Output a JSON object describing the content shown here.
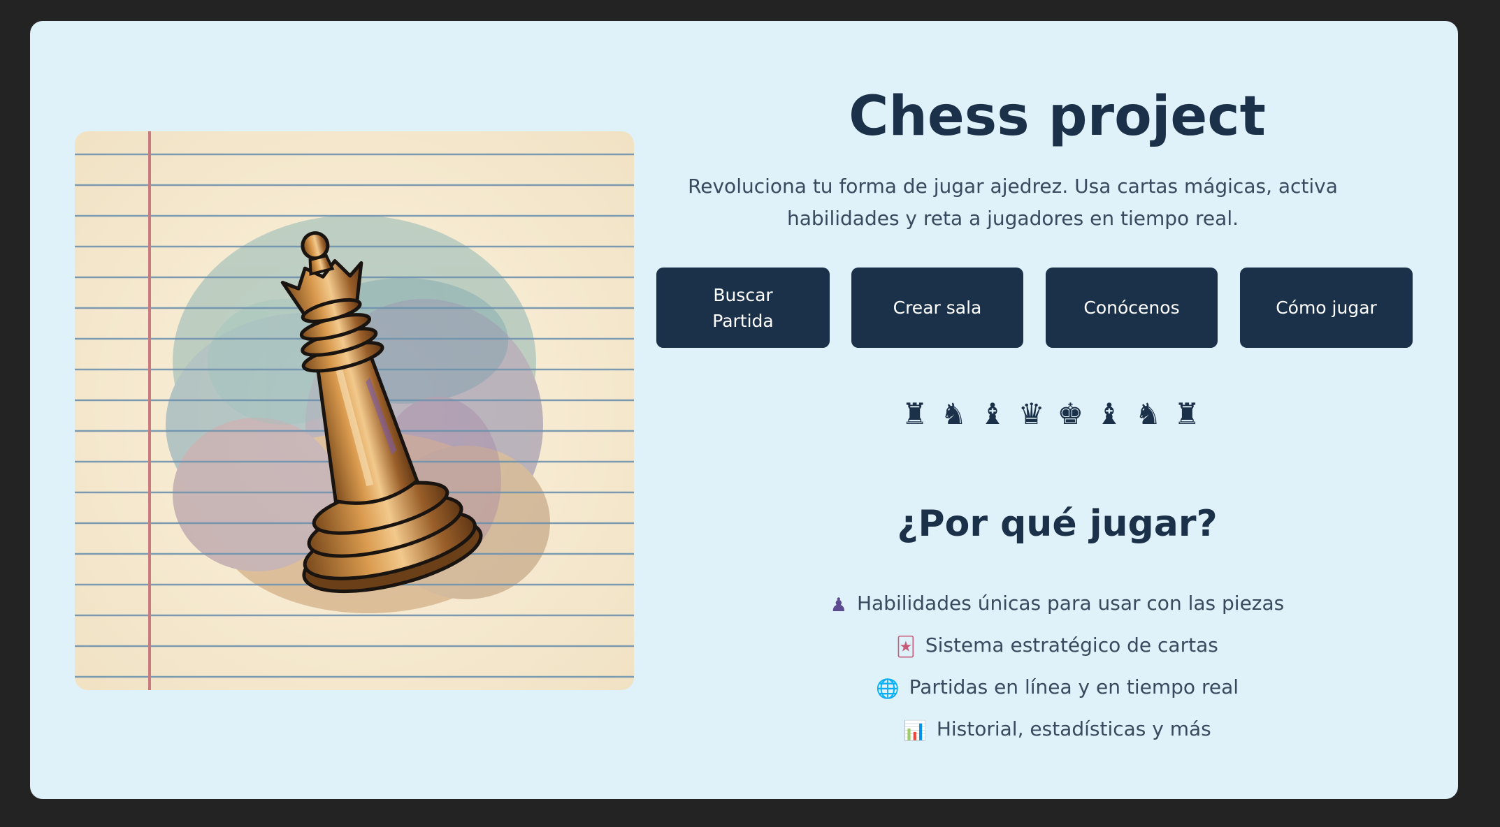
{
  "hero": {
    "title": "Chess project",
    "subtitle": "Revoluciona tu forma de jugar ajedrez. Usa cartas mágicas, activa habilidades y reta a jugadores en tiempo real."
  },
  "actions": [
    {
      "label": "Buscar Partida"
    },
    {
      "label": "Crear sala"
    },
    {
      "label": "Conócenos"
    },
    {
      "label": "Cómo jugar"
    }
  ],
  "pieces_row": "♜♞♝♛♚♝♞♜",
  "why": {
    "heading": "¿Por qué jugar?",
    "features": [
      {
        "icon": "pawn-icon",
        "glyph": "♟",
        "text": "Habilidades únicas para usar con las piezas"
      },
      {
        "icon": "joker-card-icon",
        "glyph": "🃏",
        "text": "Sistema estratégico de cartas"
      },
      {
        "icon": "globe-icon",
        "glyph": "🌐",
        "text": "Partidas en línea y en tiempo real"
      },
      {
        "icon": "bar-chart-icon",
        "glyph": "📊",
        "text": "Historial, estadísticas y más"
      }
    ]
  },
  "colors": {
    "page_background": "#232323",
    "card_background": "#dff1f9",
    "primary": "#1b3049",
    "text": "#384a5e",
    "paper": "#f5e9cf",
    "paper_lines": "#6f92ad",
    "margin_line": "#c97a7e"
  }
}
